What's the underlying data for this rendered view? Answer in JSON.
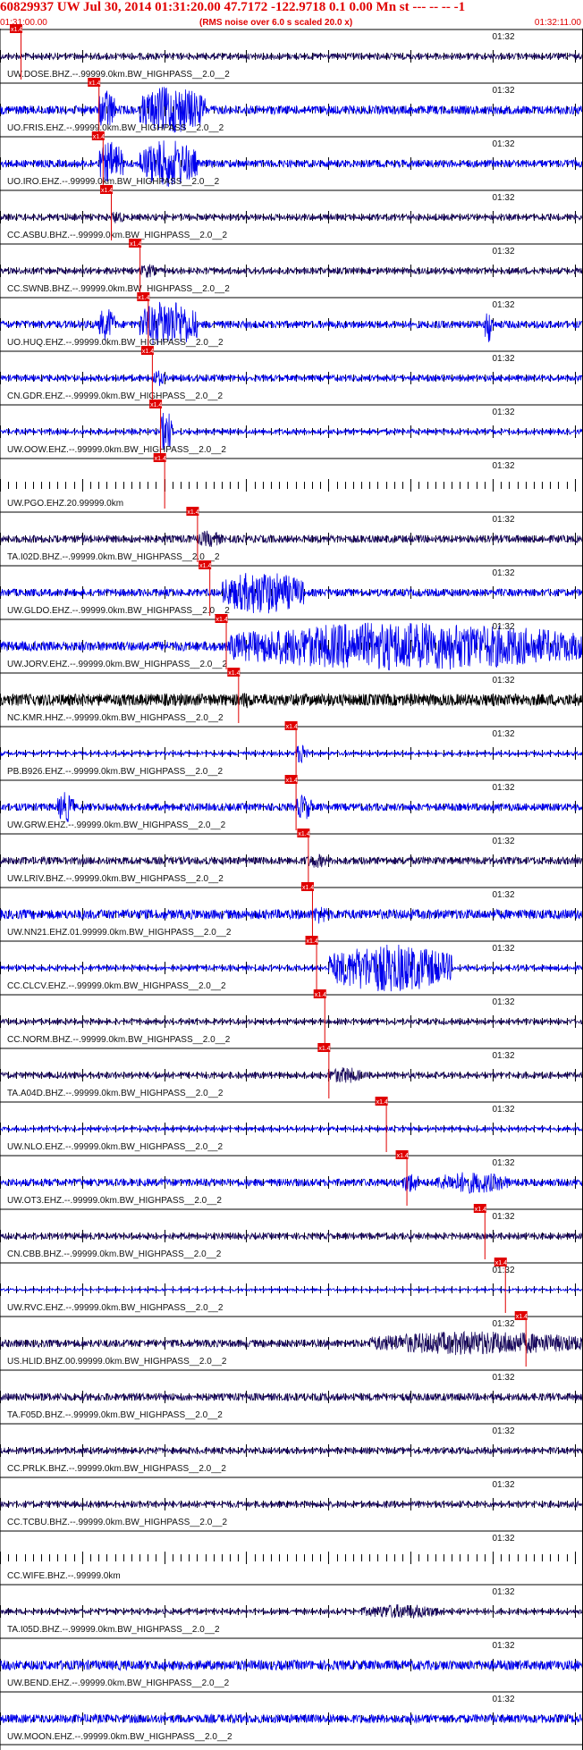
{
  "header": {
    "title": "60829937 UW Jul 30, 2014 01:31:20.00   47.7172 -122.9718  0.1 0.00 Mn st --- -- --  -1",
    "subtitle": "(RMS noise over 6.0 s scaled 20.0 x)",
    "start_time": "01:31:00.00",
    "end_time": "01:32:11.00"
  },
  "colors": {
    "header_red": "#e00000",
    "pick_red": "#e00000",
    "trace_blue": "#0000ee",
    "trace_navy": "#1a0a5e",
    "trace_black": "#000000"
  },
  "chart_data": {
    "type": "line",
    "title": "60829937 UW Jul 30, 2014 01:31:20.00",
    "x_range": [
      "01:31:00.00",
      "01:32:11.00"
    ],
    "x_range_seconds": [
      0,
      71
    ],
    "minute_mark_label": "01:32",
    "minute_mark_seconds": 60,
    "pick_label": "x1.4",
    "series": [
      {
        "name": "UW.DOSE.BHZ.--.99999.0km.BW_HIGHPASS__2.0__2",
        "color": "#1a0a5e",
        "pick_s": 2.5,
        "amp": 0.12,
        "bursts": []
      },
      {
        "name": "UO.FRIS.EHZ.--.99999.0km.BW_HIGHPASS__2.0__2",
        "color": "#0000ee",
        "pick_s": 12.0,
        "amp": 0.18,
        "bursts": [
          [
            12,
            14,
            0.9
          ],
          [
            17,
            25,
            1.0
          ]
        ]
      },
      {
        "name": "UO.IRO.EHZ.--.99999.0km.BW_HIGHPASS__2.0__2",
        "color": "#0000ee",
        "pick_s": 12.5,
        "amp": 0.15,
        "bursts": [
          [
            12,
            15,
            0.9
          ],
          [
            17,
            24,
            1.0
          ]
        ]
      },
      {
        "name": "CC.ASBU.BHZ.--.99999.0km.BW_HIGHPASS__2.0__2",
        "color": "#1a0a5e",
        "pick_s": 13.5,
        "amp": 0.12,
        "bursts": [
          [
            13.5,
            15,
            0.3
          ]
        ]
      },
      {
        "name": "CC.SWNB.BHZ.--.99999.0km.BW_HIGHPASS__2.0__2",
        "color": "#1a0a5e",
        "pick_s": 17.0,
        "amp": 0.12,
        "bursts": [
          [
            17,
            19,
            0.3
          ]
        ]
      },
      {
        "name": "UO.HUQ.EHZ.--.99999.0km.BW_HIGHPASS__2.0__2",
        "color": "#0000ee",
        "pick_s": 18.0,
        "amp": 0.15,
        "bursts": [
          [
            12,
            14,
            0.7
          ],
          [
            17,
            24,
            1.0
          ],
          [
            59,
            60,
            0.8
          ]
        ]
      },
      {
        "name": "CN.GDR.EHZ.--.99999.0km.BW_HIGHPASS__2.0__2",
        "color": "#0000ee",
        "pick_s": 18.5,
        "amp": 0.12,
        "bursts": [
          [
            18.5,
            20,
            0.35
          ]
        ]
      },
      {
        "name": "UW.OOW.EHZ.--.99999.0km.BW_HIGHPASS__2.0__2",
        "color": "#0000ee",
        "pick_s": 19.5,
        "amp": 0.1,
        "bursts": [
          [
            19.5,
            21,
            0.9
          ]
        ]
      },
      {
        "name": "UW.PGO.EHZ.20.99999.0km",
        "color": "#000000",
        "pick_s": 20.0,
        "amp": 0.0,
        "bursts": []
      },
      {
        "name": "TA.I02D.BHZ.--.99999.0km.BW_HIGHPASS__2.0__2",
        "color": "#1a0a5e",
        "pick_s": 24.0,
        "amp": 0.15,
        "bursts": [
          [
            24,
            27,
            0.35
          ]
        ]
      },
      {
        "name": "UW.GLDO.EHZ.--.99999.0km.BW_HIGHPASS__2.0__2",
        "color": "#0000ee",
        "pick_s": 25.5,
        "amp": 0.15,
        "bursts": [
          [
            27,
            37,
            0.9
          ]
        ]
      },
      {
        "name": "UW.JORV.EHZ.--.99999.0km.BW_HIGHPASS__2.0__2",
        "color": "#0000ee",
        "pick_s": 27.5,
        "amp": 0.2,
        "bursts": [
          [
            28,
            71,
            1.0
          ]
        ]
      },
      {
        "name": "NC.KMR.HHZ.--.99999.0km.BW_HIGHPASS__2.0__2",
        "color": "#000000",
        "pick_s": 29.0,
        "amp": 0.25,
        "bursts": [
          [
            29,
            31,
            0.35
          ]
        ]
      },
      {
        "name": "PB.B926.EHZ.--.99999.0km.BW_HIGHPASS__2.0__2",
        "color": "#0000ee",
        "pick_s": 36.0,
        "amp": 0.08,
        "bursts": [
          [
            36,
            37.5,
            0.45
          ]
        ]
      },
      {
        "name": "UW.GRW.EHZ.--.99999.0km.BW_HIGHPASS__2.0__2",
        "color": "#0000ee",
        "pick_s": 36.0,
        "amp": 0.15,
        "bursts": [
          [
            7,
            9,
            0.65
          ],
          [
            36,
            38,
            0.55
          ]
        ]
      },
      {
        "name": "UW.LRIV.BHZ.--.99999.0km.BW_HIGHPASS__2.0__2",
        "color": "#1a0a5e",
        "pick_s": 37.5,
        "amp": 0.15,
        "bursts": [
          [
            37,
            40,
            0.3
          ]
        ]
      },
      {
        "name": "UW.NN21.EHZ.01.99999.0km.BW_HIGHPASS__2.0__2",
        "color": "#0000ee",
        "pick_s": 38.0,
        "amp": 0.2,
        "bursts": [
          [
            38,
            40,
            0.4
          ]
        ]
      },
      {
        "name": "CC.CLCV.EHZ.--.99999.0km.BW_HIGHPASS__2.0__2",
        "color": "#0000ee",
        "pick_s": 38.5,
        "amp": 0.1,
        "bursts": [
          [
            40,
            55,
            1.0
          ]
        ]
      },
      {
        "name": "CC.NORM.BHZ.--.99999.0km.BW_HIGHPASS__2.0__2",
        "color": "#1a0a5e",
        "pick_s": 39.5,
        "amp": 0.1,
        "bursts": []
      },
      {
        "name": "TA.A04D.BHZ.--.99999.0km.BW_HIGHPASS__2.0__2",
        "color": "#1a0a5e",
        "pick_s": 40.0,
        "amp": 0.12,
        "bursts": [
          [
            40,
            44,
            0.35
          ]
        ]
      },
      {
        "name": "UW.NLO.EHZ.--.99999.0km.BW_HIGHPASS__2.0__2",
        "color": "#0000ee",
        "pick_s": 47.0,
        "amp": 0.08,
        "bursts": []
      },
      {
        "name": "UW.OT3.EHZ.--.99999.0km.BW_HIGHPASS__2.0__2",
        "color": "#0000ee",
        "pick_s": 49.5,
        "amp": 0.15,
        "bursts": [
          [
            49,
            51,
            0.45
          ],
          [
            53,
            62,
            0.45
          ]
        ]
      },
      {
        "name": "CN.CBB.BHZ.--.99999.0km.BW_HIGHPASS__2.0__2",
        "color": "#1a0a5e",
        "pick_s": 59.0,
        "amp": 0.12,
        "bursts": []
      },
      {
        "name": "UW.RVC.EHZ.--.99999.0km.BW_HIGHPASS__2.0__2",
        "color": "#0000ee",
        "pick_s": 61.5,
        "amp": 0.05,
        "bursts": []
      },
      {
        "name": "US.HLID.BHZ.00.99999.0km.BW_HIGHPASS__2.0__2",
        "color": "#1a0a5e",
        "pick_s": 64.0,
        "amp": 0.15,
        "bursts": [
          [
            45,
            71,
            0.5
          ]
        ]
      },
      {
        "name": "TA.F05D.BHZ.--.99999.0km.BW_HIGHPASS__2.0__2",
        "color": "#1a0a5e",
        "pick_s": null,
        "amp": 0.15,
        "bursts": []
      },
      {
        "name": "CC.PRLK.BHZ.--.99999.0km.BW_HIGHPASS__2.0__2",
        "color": "#1a0a5e",
        "pick_s": null,
        "amp": 0.12,
        "bursts": []
      },
      {
        "name": "CC.TCBU.BHZ.--.99999.0km.BW_HIGHPASS__2.0__2",
        "color": "#1a0a5e",
        "pick_s": null,
        "amp": 0.12,
        "bursts": []
      },
      {
        "name": "CC.WIFE.BHZ.--.99999.0km",
        "color": "#000000",
        "pick_s": null,
        "amp": 0.0,
        "bursts": []
      },
      {
        "name": "TA.I05D.BHZ.--.99999.0km.BW_HIGHPASS__2.0__2",
        "color": "#1a0a5e",
        "pick_s": null,
        "amp": 0.1,
        "bursts": [
          [
            44,
            54,
            0.3
          ]
        ]
      },
      {
        "name": "UW.BEND.EHZ.--.99999.0km.BW_HIGHPASS__2.0__2",
        "color": "#0000ee",
        "pick_s": null,
        "amp": 0.2,
        "bursts": []
      },
      {
        "name": "UW.MOON.EHZ.--.99999.0km.BW_HIGHPASS__2.0__2",
        "color": "#0000ee",
        "pick_s": null,
        "amp": 0.18,
        "bursts": []
      }
    ]
  }
}
